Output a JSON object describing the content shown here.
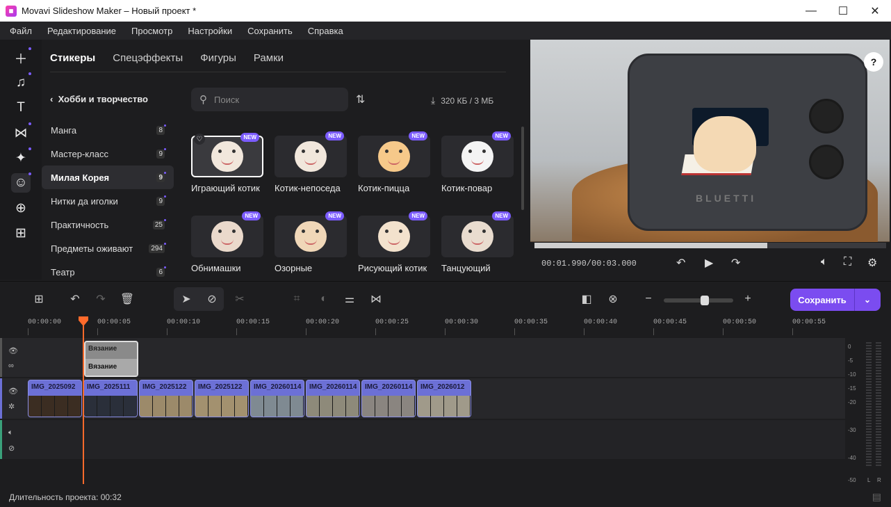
{
  "window": {
    "title": "Movavi Slideshow Maker – Новый проект *"
  },
  "menu": [
    "Файл",
    "Редактирование",
    "Просмотр",
    "Настройки",
    "Сохранить",
    "Справка"
  ],
  "sidebar": {
    "icons": [
      "add-icon",
      "music-icon",
      "text-icon",
      "transitions-icon",
      "effects-icon",
      "stickers-icon",
      "store-icon",
      "more-icon"
    ]
  },
  "library": {
    "tabs": [
      "Стикеры",
      "Спецэффекты",
      "Фигуры",
      "Рамки"
    ],
    "category_title": "Хобби и творчество",
    "categories": [
      {
        "label": "Манга",
        "count": "8"
      },
      {
        "label": "Мастер-класс",
        "count": "9"
      },
      {
        "label": "Милая Корея",
        "count": "9"
      },
      {
        "label": "Нитки да иголки",
        "count": "9"
      },
      {
        "label": "Практичность",
        "count": "25"
      },
      {
        "label": "Предметы оживают",
        "count": "294"
      },
      {
        "label": "Театр",
        "count": "6"
      }
    ],
    "search_placeholder": "Поиск",
    "storage": "320 КБ / 3 МБ",
    "new_badge": "NEW",
    "items": [
      "Играющий котик",
      "Котик-непоседа",
      "Котик-пицца",
      "Котик-повар",
      "Обнимашки",
      "Озорные",
      "Рисующий котик",
      "Танцующий"
    ]
  },
  "preview": {
    "brand_text": "BLUETTI",
    "timecode": "00:01.990/00:03.000",
    "progress_fraction": 0.663
  },
  "toolbar": {
    "save_label": "Сохранить",
    "zoom_fraction": 0.6
  },
  "timeline": {
    "ticks": [
      "00:00:00",
      "00:00:05",
      "00:00:10",
      "00:00:15",
      "00:00:20",
      "00:00:25",
      "00:00:30",
      "00:00:35",
      "00:00:40",
      "00:00:45",
      "00:00:50",
      "00:00:55"
    ],
    "text_clip": {
      "title": "Вязание",
      "subtitle": "Вязание"
    },
    "video_clips": [
      "IMG_2025092",
      "IMG_2025111",
      "IMG_2025122",
      "IMG_2025122",
      "IMG_20260114",
      "IMG_20260114",
      "IMG_20260114",
      "IMG_2026012"
    ]
  },
  "meter": {
    "levels": [
      "0",
      "-5",
      "-10",
      "-15",
      "-20",
      "-30",
      "-40",
      "-50",
      "-60"
    ],
    "left": "L",
    "right": "R"
  },
  "status": {
    "duration": "Длительность проекта: 00:32"
  }
}
